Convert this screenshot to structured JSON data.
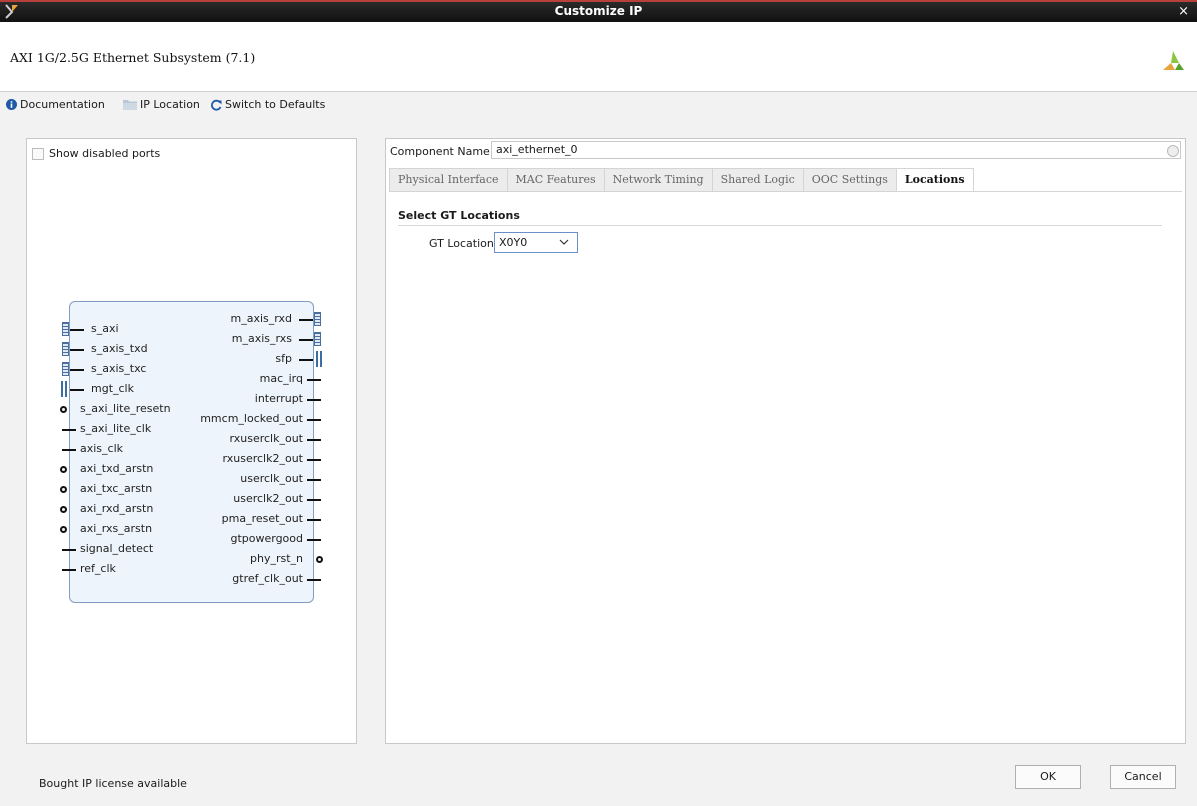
{
  "window": {
    "title": "Customize IP",
    "close_label": "×"
  },
  "header": {
    "ip_title": "AXI 1G/2.5G Ethernet Subsystem (7.1)"
  },
  "toolbar": {
    "documentation": "Documentation",
    "ip_location": "IP Location",
    "switch_defaults": "Switch to Defaults"
  },
  "left": {
    "show_disabled_ports": "Show disabled ports",
    "ports_left": [
      "s_axi",
      "s_axis_txd",
      "s_axis_txc",
      "mgt_clk",
      "s_axi_lite_resetn",
      "s_axi_lite_clk",
      "axis_clk",
      "axi_txd_arstn",
      "axi_txc_arstn",
      "axi_rxd_arstn",
      "axi_rxs_arstn",
      "signal_detect",
      "ref_clk"
    ],
    "ports_right": [
      "m_axis_rxd",
      "m_axis_rxs",
      "sfp",
      "mac_irq",
      "interrupt",
      "mmcm_locked_out",
      "rxuserclk_out",
      "rxuserclk2_out",
      "userclk_out",
      "userclk2_out",
      "pma_reset_out",
      "gtpowergood",
      "phy_rst_n",
      "gtref_clk_out"
    ]
  },
  "component": {
    "label": "Component Name",
    "value": "axi_ethernet_0"
  },
  "tabs": [
    "Physical Interface",
    "MAC Features",
    "Network Timing",
    "Shared Logic",
    "OOC Settings",
    "Locations"
  ],
  "locations": {
    "section_title": "Select GT Locations",
    "gt_label": "GT Location",
    "gt_value": "X0Y0"
  },
  "footer": {
    "status": "Bought IP license available",
    "ok": "OK",
    "cancel": "Cancel"
  },
  "colors": {
    "title_bar": "#1a1a1a",
    "title_accent": "#b8403a",
    "symbol_fill": "#eef4fb",
    "symbol_border": "#7f9ec0",
    "logo": "#8cc63f"
  }
}
